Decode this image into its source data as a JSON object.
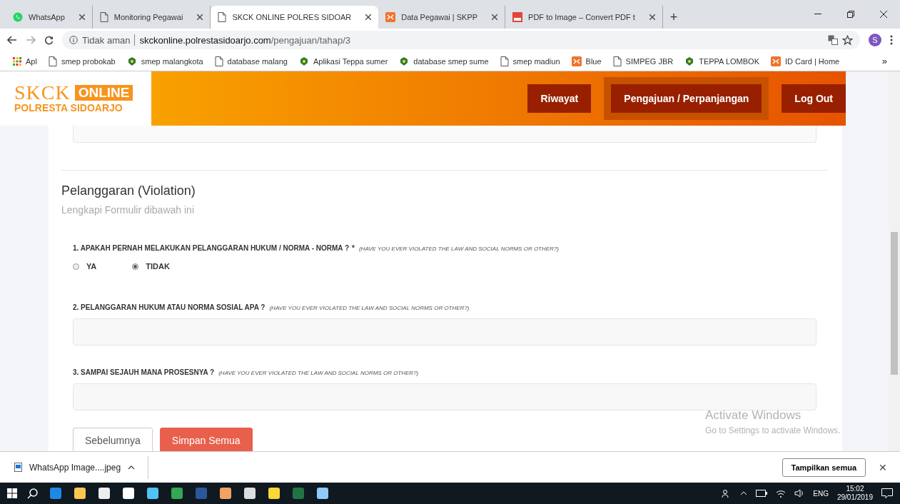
{
  "browser": {
    "tabs": [
      {
        "title": "WhatsApp",
        "kind": "whatsapp",
        "selected": false
      },
      {
        "title": "Monitoring Pegawai",
        "kind": "page",
        "selected": false
      },
      {
        "title": "SKCK ONLINE POLRES SIDOAR",
        "kind": "page",
        "selected": true
      },
      {
        "title": "Data Pegawai | SKPP",
        "kind": "orange",
        "selected": false
      },
      {
        "title": "PDF to Image – Convert PDF t",
        "kind": "pdf",
        "selected": false
      }
    ],
    "new_tab": "+",
    "address": {
      "security": "Tidak aman",
      "host": "skckonline.polrestasidoarjo.com",
      "path": "/pengajuan/tahap/3"
    },
    "profile": "S",
    "bookmarks": [
      {
        "label": "Apl",
        "kind": "apps"
      },
      {
        "label": "smep probokab",
        "kind": "page"
      },
      {
        "label": "smep malangkota",
        "kind": "emblem"
      },
      {
        "label": "database malang",
        "kind": "page"
      },
      {
        "label": "Aplikasi Teppa sumer",
        "kind": "emblem"
      },
      {
        "label": "database smep sume",
        "kind": "emblem"
      },
      {
        "label": "smep madiun",
        "kind": "page"
      },
      {
        "label": "Blue",
        "kind": "orange"
      },
      {
        "label": "SIMPEG JBR",
        "kind": "page"
      },
      {
        "label": "TEPPA LOMBOK",
        "kind": "emblem"
      },
      {
        "label": "ID Card | Home",
        "kind": "orange"
      }
    ],
    "bookmarks_more": "»"
  },
  "site": {
    "logo": {
      "name": "SKCK",
      "badge": "ONLINE",
      "subtitle": "POLRESTA SIDOARJO"
    },
    "nav": [
      {
        "label": "Riwayat",
        "selected": false
      },
      {
        "label": "Pengajuan / Perpanjangan",
        "selected": true
      },
      {
        "label": "Log Out",
        "selected": false
      }
    ]
  },
  "form": {
    "title": "Pelanggaran (Violation)",
    "subtitle": "Lengkapi Formulir dibawah ini",
    "questions": [
      {
        "kind": "radio",
        "label": "1. APAKAH PERNAH MELAKUKAN PELANGGARAN HUKUM / NORMA - NORMA ?",
        "required_mark": "*",
        "hint": "(HAVE YOU EVER VIOLATED THE LAW AND SOCIAL NORMS OR OTHER?)",
        "options": [
          {
            "label": "YA",
            "selected": false
          },
          {
            "label": "TIDAK",
            "selected": true
          }
        ]
      },
      {
        "kind": "text",
        "label": "2. PELANGGARAN HUKUM ATAU NORMA SOSIAL APA ?",
        "hint": "(HAVE YOU EVER VIOLATED THE LAW AND SOCIAL NORMS OR OTHER?)"
      },
      {
        "kind": "text",
        "label": "3. SAMPAI SEJAUH MANA PROSESNYA ?",
        "hint": "(HAVE YOU EVER VIOLATED THE LAW AND SOCIAL NORMS OR OTHER?)"
      }
    ],
    "buttons": [
      {
        "label": "Sebelumnya",
        "kind": "secondary"
      },
      {
        "label": "Simpan Semua",
        "kind": "primary"
      }
    ]
  },
  "watermark": {
    "title": "Activate Windows",
    "subtitle": "Go to Settings to activate Windows."
  },
  "downloads": {
    "file": "WhatsApp Image....jpeg",
    "show_all": "Tampilkan semua",
    "close": "✕"
  },
  "taskbar": {
    "language": "ENG",
    "time": "15:02",
    "date": "29/01/2019"
  }
}
